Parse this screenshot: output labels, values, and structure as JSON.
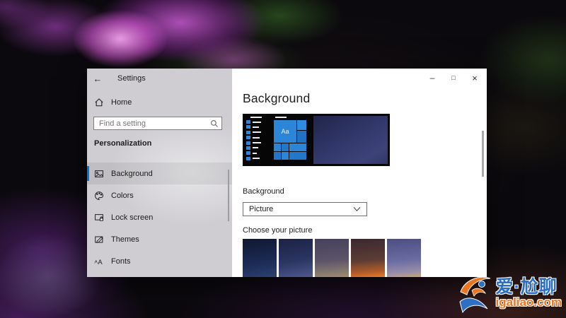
{
  "colors": {
    "accent": "#0078d7",
    "watermark_blue": "#2d6fc3",
    "watermark_orange": "#ee7520",
    "wallpaper_pink": "#d965d8",
    "wallpaper_green": "#2c4a16",
    "wallpaper_purple": "#5a2470"
  },
  "window": {
    "titlebar": {
      "back_glyph": "←",
      "title": "Settings",
      "controls": [
        {
          "name": "minimize",
          "glyph": "–"
        },
        {
          "name": "maximize",
          "glyph": "□"
        },
        {
          "name": "close",
          "glyph": "×"
        }
      ]
    },
    "sidebar": {
      "home_label": "Home",
      "search_placeholder": "Find a setting",
      "section_header": "Personalization",
      "items": [
        {
          "label": "Background",
          "icon": "image-icon",
          "selected": true
        },
        {
          "label": "Colors",
          "icon": "palette-icon",
          "selected": false
        },
        {
          "label": "Lock screen",
          "icon": "lock-screen-icon",
          "selected": false
        },
        {
          "label": "Themes",
          "icon": "themes-icon",
          "selected": false
        },
        {
          "label": "Fonts",
          "icon": "fonts-icon",
          "selected": false
        }
      ]
    },
    "main": {
      "title": "Background",
      "preview": {
        "start_tile_label": "Aa",
        "desktop_gradient": "linear-gradient(150deg,#20254a 0%,#343a6e 55%,#3d4378 80%,#303666 100%)"
      },
      "background_label": "Background",
      "background_type_value": "Picture",
      "choose_label": "Choose your picture",
      "thumbnails": [
        {
          "gradient": "linear-gradient(170deg,#10172e 0%,#1c2b56 60%,#2d4170 100%)"
        },
        {
          "gradient": "linear-gradient(170deg,#1d2243 0%,#2b3562 55%,#4e5a8e 100%)"
        },
        {
          "gradient": "linear-gradient(175deg,#45405a 0%,#5c5568 55%,#8d7f70 88%,#ab8c64 100%)"
        },
        {
          "gradient": "linear-gradient(175deg,#3a2830 0%,#5d3d34 55%,#b85f28 85%,#e8832c 100%)"
        },
        {
          "gradient": "linear-gradient(175deg,#4c4e80 0%,#6b6ca2 55%,#9b90a8 85%,#d6a468 100%)"
        }
      ]
    }
  },
  "watermark": {
    "title": "爱·尬聊",
    "site": "igaliao.com"
  }
}
